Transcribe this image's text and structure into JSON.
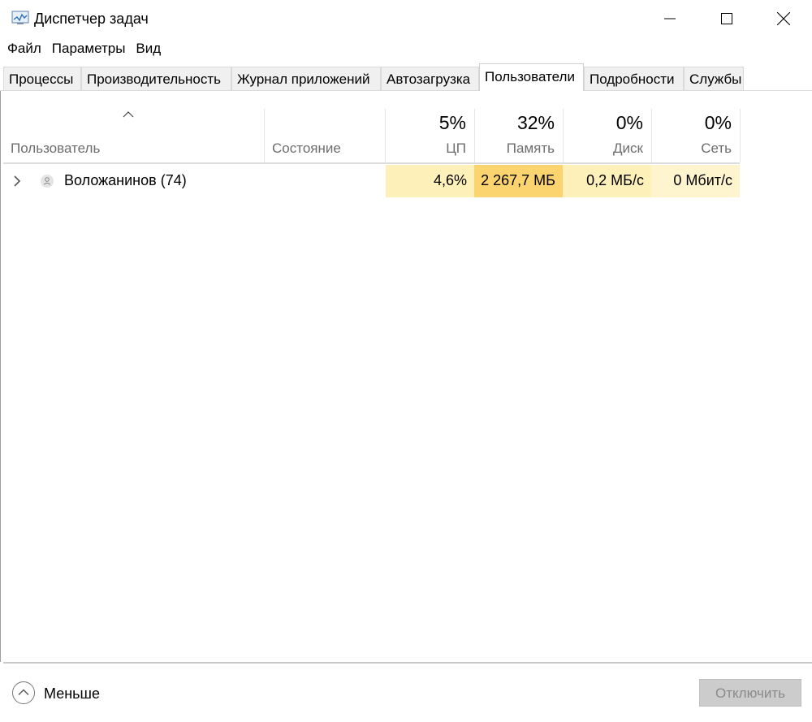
{
  "window": {
    "title": "Диспетчер задач",
    "icons": {
      "app": "task-manager-icon",
      "minimize": "minimize-icon",
      "maximize": "maximize-icon",
      "close": "close-icon"
    }
  },
  "menu": [
    "Файл",
    "Параметры",
    "Вид"
  ],
  "tabs": [
    "Процессы",
    "Производительность",
    "Журнал приложений",
    "Автозагрузка",
    "Пользователи",
    "Подробности",
    "Службы"
  ],
  "active_tab": "Пользователи",
  "columns": {
    "user": {
      "label": "Пользователь",
      "sort": "ascending"
    },
    "status": {
      "label": "Состояние"
    },
    "cpu": {
      "label": "ЦП",
      "total": "5%"
    },
    "memory": {
      "label": "Память",
      "total": "32%"
    },
    "disk": {
      "label": "Диск",
      "total": "0%"
    },
    "network": {
      "label": "Сеть",
      "total": "0%"
    }
  },
  "rows": [
    {
      "name": "Воложанинов (74)",
      "status": "",
      "cpu": "4,6%",
      "memory": "2 267,7 МБ",
      "disk": "0,2 МБ/с",
      "network": "0 Мбит/с",
      "expanded": false
    }
  ],
  "footer": {
    "less_label": "Меньше",
    "disconnect_label": "Отключить",
    "disconnect_enabled": false
  },
  "colors": {
    "heat_low": "#fdf0b8",
    "heat_high": "#fbd470",
    "heat_lowest": "#fef5cf"
  }
}
